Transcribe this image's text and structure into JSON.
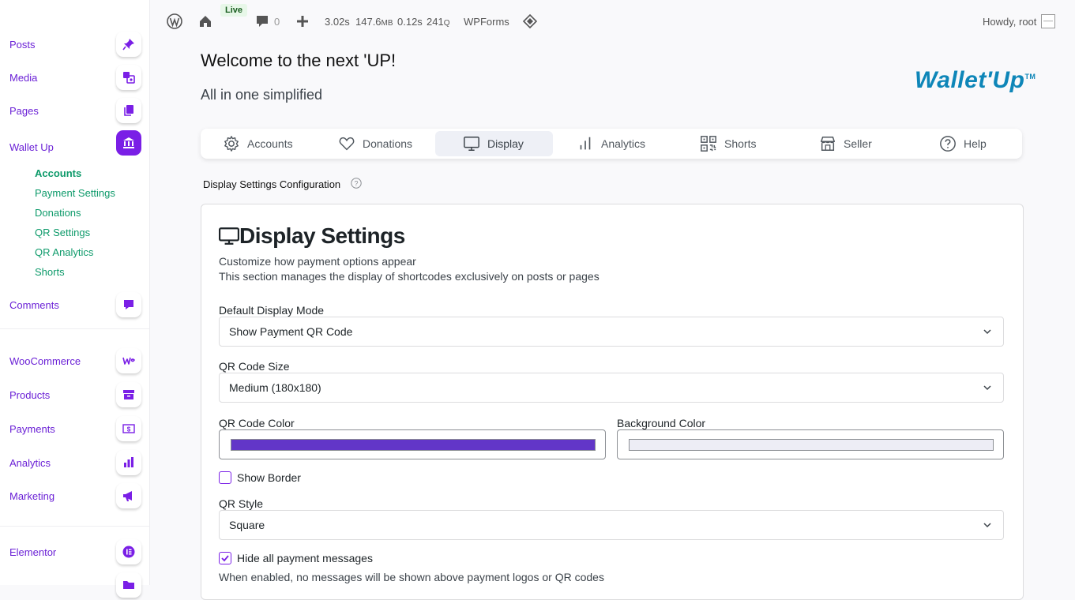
{
  "adminbar": {
    "live_badge": "Live",
    "comment_count": "0",
    "perf_time": "3.02s",
    "perf_mem_value": "147.6",
    "perf_mem_unit": "MB",
    "perf_query_time": "0.12s",
    "perf_queries_value": "241",
    "perf_queries_unit": "Q",
    "wpforms": "WPForms",
    "howdy": "Howdy, root"
  },
  "sidebar": {
    "items": [
      {
        "label": "Posts",
        "icon": "pin-icon"
      },
      {
        "label": "Media",
        "icon": "media-icon"
      },
      {
        "label": "Pages",
        "icon": "pages-icon"
      },
      {
        "label": "Wallet Up",
        "icon": "bank-icon"
      },
      {
        "label": "Comments",
        "icon": "comment-icon"
      },
      {
        "label": "WooCommerce",
        "icon": "woo-icon"
      },
      {
        "label": "Products",
        "icon": "archive-icon"
      },
      {
        "label": "Payments",
        "icon": "money-icon"
      },
      {
        "label": "Analytics",
        "icon": "chart-icon"
      },
      {
        "label": "Marketing",
        "icon": "megaphone-icon"
      },
      {
        "label": "Elementor",
        "icon": "elementor-icon"
      }
    ],
    "submenu": [
      "Accounts",
      "Payment Settings",
      "Donations",
      "QR Settings",
      "QR Analytics",
      "Shorts"
    ]
  },
  "header": {
    "welcome": "Welcome to the next 'UP!",
    "subtitle": "All in one simplified",
    "logo_text": "Wallet'Up",
    "logo_tm": "TM"
  },
  "tabs": [
    {
      "label": "Accounts",
      "icon": "gear-icon"
    },
    {
      "label": "Donations",
      "icon": "heart-icon"
    },
    {
      "label": "Display",
      "icon": "monitor-icon",
      "active": true
    },
    {
      "label": "Analytics",
      "icon": "bar-chart-icon"
    },
    {
      "label": "Shorts",
      "icon": "qr-icon"
    },
    {
      "label": "Seller",
      "icon": "store-icon"
    },
    {
      "label": "Help",
      "icon": "help-icon"
    }
  ],
  "config_label": "Display Settings Configuration",
  "card": {
    "title": "Display Settings",
    "desc1": "Customize how payment options appear",
    "desc2": "This section manages the display of shortcodes exclusively on posts or pages",
    "display_mode_label": "Default Display Mode",
    "display_mode_value": "Show Payment QR Code",
    "qr_size_label": "QR Code Size",
    "qr_size_value": "Medium (180x180)",
    "qr_color_label": "QR Code Color",
    "qr_color": "#6236c8",
    "bg_color_label": "Background Color",
    "bg_color": "#ededf5",
    "show_border_label": "Show Border",
    "show_border_checked": false,
    "qr_style_label": "QR Style",
    "qr_style_value": "Square",
    "hide_messages_label": "Hide all payment messages",
    "hide_messages_checked": true,
    "hide_messages_desc": "When enabled, no messages will be shown above payment logos or QR codes"
  },
  "colors": {
    "accent": "#7a1fe6",
    "submenu": "#0d9a6a"
  }
}
